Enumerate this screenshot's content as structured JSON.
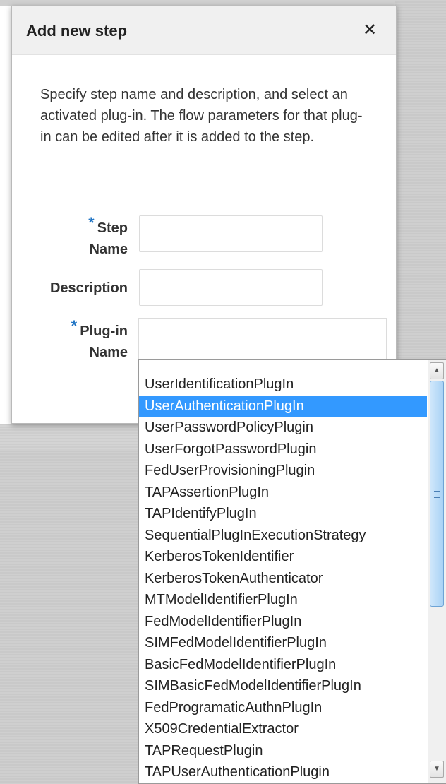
{
  "dialog": {
    "title": "Add new step",
    "close_glyph": "✕",
    "intro": "Specify step name and description, and select an activated plug-in. The flow parameters for that plug-in can be edited after it is added to the step."
  },
  "form": {
    "required_mark": "*",
    "step_name_label_line1": "Step",
    "step_name_label_line2": "Name",
    "step_name_value": "",
    "description_label": "Description",
    "description_value": "",
    "plugin_label_line1": "Plug-in",
    "plugin_label_line2": "Name",
    "plugin_value": ""
  },
  "dropdown": {
    "selected_index": 1,
    "options": [
      "UserIdentificationPlugIn",
      "UserAuthenticationPlugIn",
      "UserPasswordPolicyPlugin",
      "UserForgotPasswordPlugin",
      "FedUserProvisioningPlugin",
      "TAPAssertionPlugIn",
      "TAPIdentifyPlugIn",
      "SequentialPlugInExecutionStrategy",
      "KerberosTokenIdentifier",
      "KerberosTokenAuthenticator",
      "MTModelIdentifierPlugIn",
      "FedModelIdentifierPlugIn",
      "SIMFedModelIdentifierPlugIn",
      "BasicFedModelIdentifierPlugIn",
      "SIMBasicFedModelIdentifierPlugIn",
      "FedProgramaticAuthnPlugIn",
      "X509CredentialExtractor",
      "TAPRequestPlugin",
      "TAPUserAuthenticationPlugin"
    ]
  },
  "icons": {
    "close": "close-icon",
    "scroll_up": "scroll-up-arrow-icon",
    "scroll_down": "scroll-down-arrow-icon",
    "grip": "scroll-grip-icon"
  },
  "colors": {
    "accent": "#1f74c4",
    "selection": "#3399ff"
  }
}
